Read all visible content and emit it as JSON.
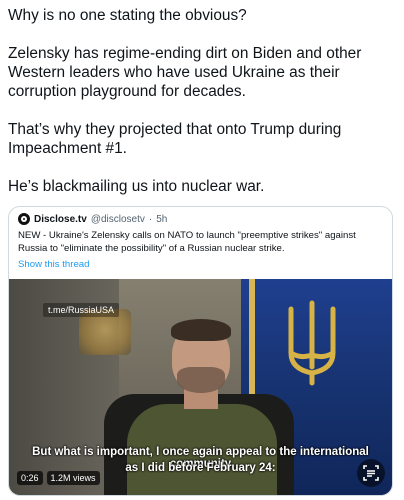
{
  "tweet": {
    "paragraphs": [
      "Why is no one stating the obvious?",
      "Zelensky has regime-ending dirt on Biden and other Western leaders who have used Ukraine as their corruption playground for decades.",
      "That’s why they projected that onto Trump during Impeachment #1.",
      "He’s blackmailing us into nuclear war."
    ]
  },
  "quote": {
    "avatar_icon": "disclose-logo-icon",
    "author_name": "Disclose.tv",
    "handle": "@disclosetv",
    "separator": "·",
    "time": "5h",
    "text": "NEW - Ukraine's Zelensky calls on NATO to launch \"preemptive strikes\" against Russia to \"eliminate the possibility\" of a Russian nuclear strike.",
    "show_thread": "Show this thread"
  },
  "video": {
    "watermark": "t.me/RussiaUSA",
    "subtitle_line1": "But what is important, I once again appeal to the international community",
    "subtitle_line2": "as I did before February 24:",
    "timestamp": "0:26",
    "views": "1.2M views",
    "corner_icon": "expand-text-icon"
  },
  "colors": {
    "text": "#0f1419",
    "secondary": "#536471",
    "link": "#1d9bf0",
    "border": "#cfd9de"
  }
}
